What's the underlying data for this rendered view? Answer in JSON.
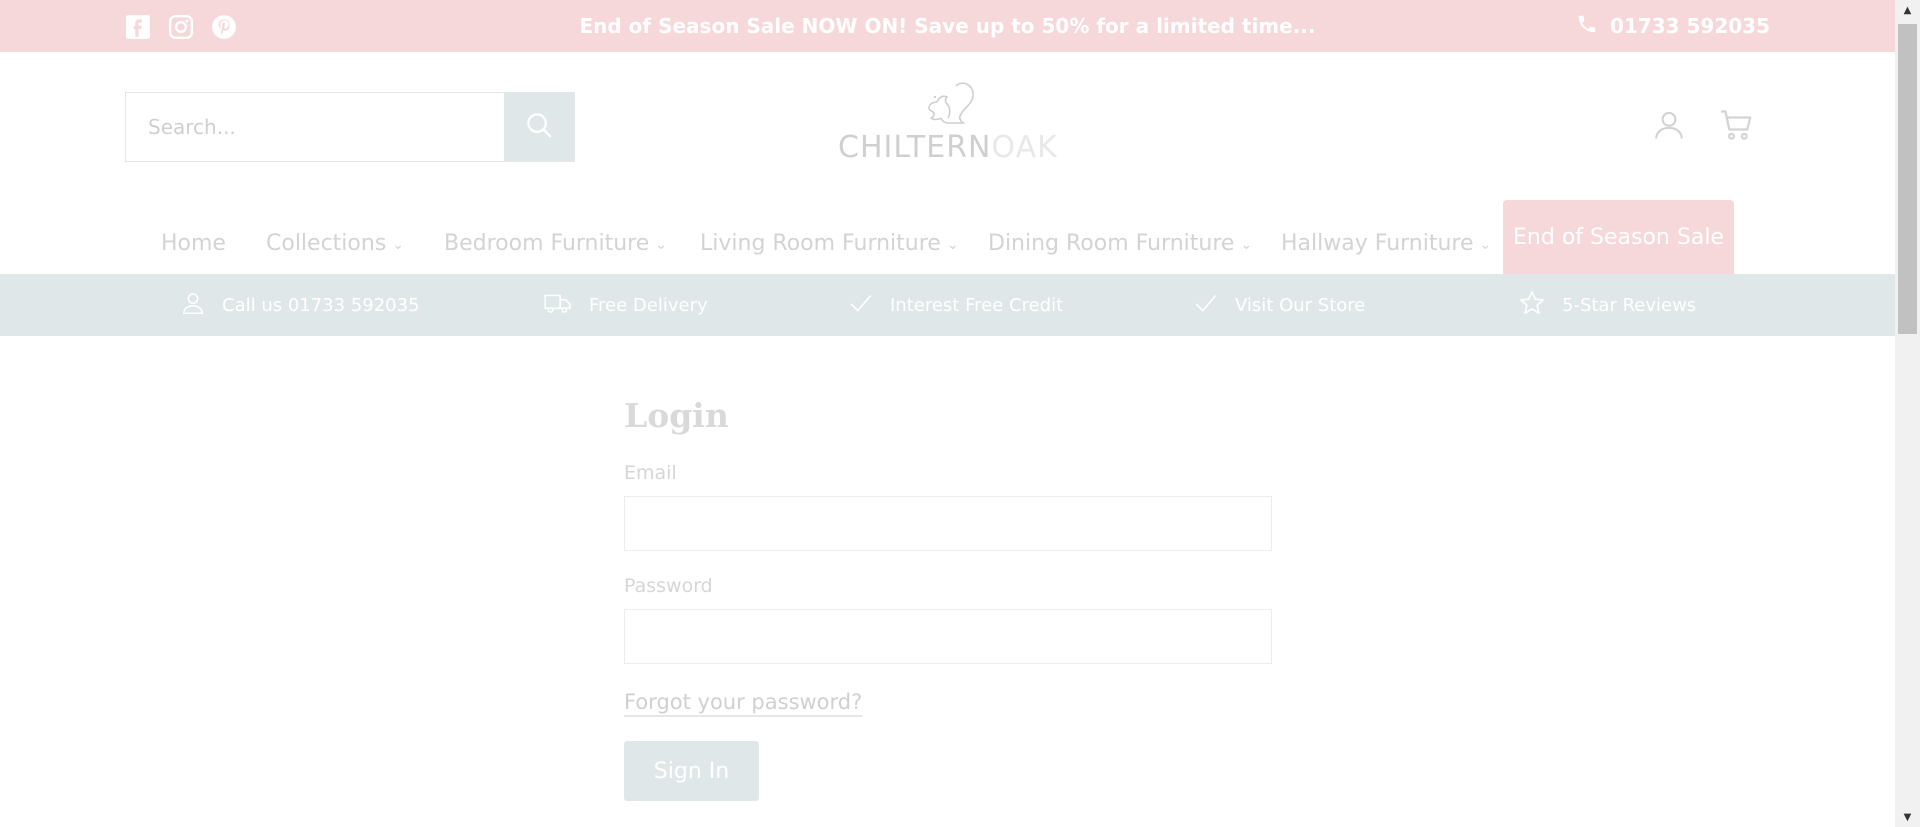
{
  "topbar": {
    "social": [
      "facebook-icon",
      "instagram-icon",
      "pinterest-icon"
    ],
    "promo": "End of Season Sale NOW ON! Save up to 50% for a limited time...",
    "phone": "01733 592035"
  },
  "header": {
    "search_placeholder": "Search...",
    "logo_text_main": "CHILTERN",
    "logo_text_accent": "OAK"
  },
  "nav": {
    "items": [
      {
        "label": "Home"
      },
      {
        "label": "Collections"
      },
      {
        "label": "Bedroom Furniture"
      },
      {
        "label": "Living Room Furniture"
      },
      {
        "label": "Dining Room Furniture"
      },
      {
        "label": "Hallway Furniture"
      }
    ],
    "sale": "End of Season Sale"
  },
  "usp": {
    "items": [
      {
        "label": "Call us 01733 592035",
        "icon": "person-icon"
      },
      {
        "label": "Free Delivery",
        "icon": "truck-icon"
      },
      {
        "label": "Interest Free Credit",
        "icon": "check-icon"
      },
      {
        "label": "Visit Our Store",
        "icon": "check-icon"
      },
      {
        "label": "5-Star Reviews",
        "icon": "star-icon"
      }
    ]
  },
  "login": {
    "title": "Login",
    "email_label": "Email",
    "password_label": "Password",
    "forgot": "Forgot your password?",
    "signin": "Sign In"
  },
  "colors": {
    "accent_pink": "#f6d8da",
    "accent_grey": "#e0e7e9"
  }
}
